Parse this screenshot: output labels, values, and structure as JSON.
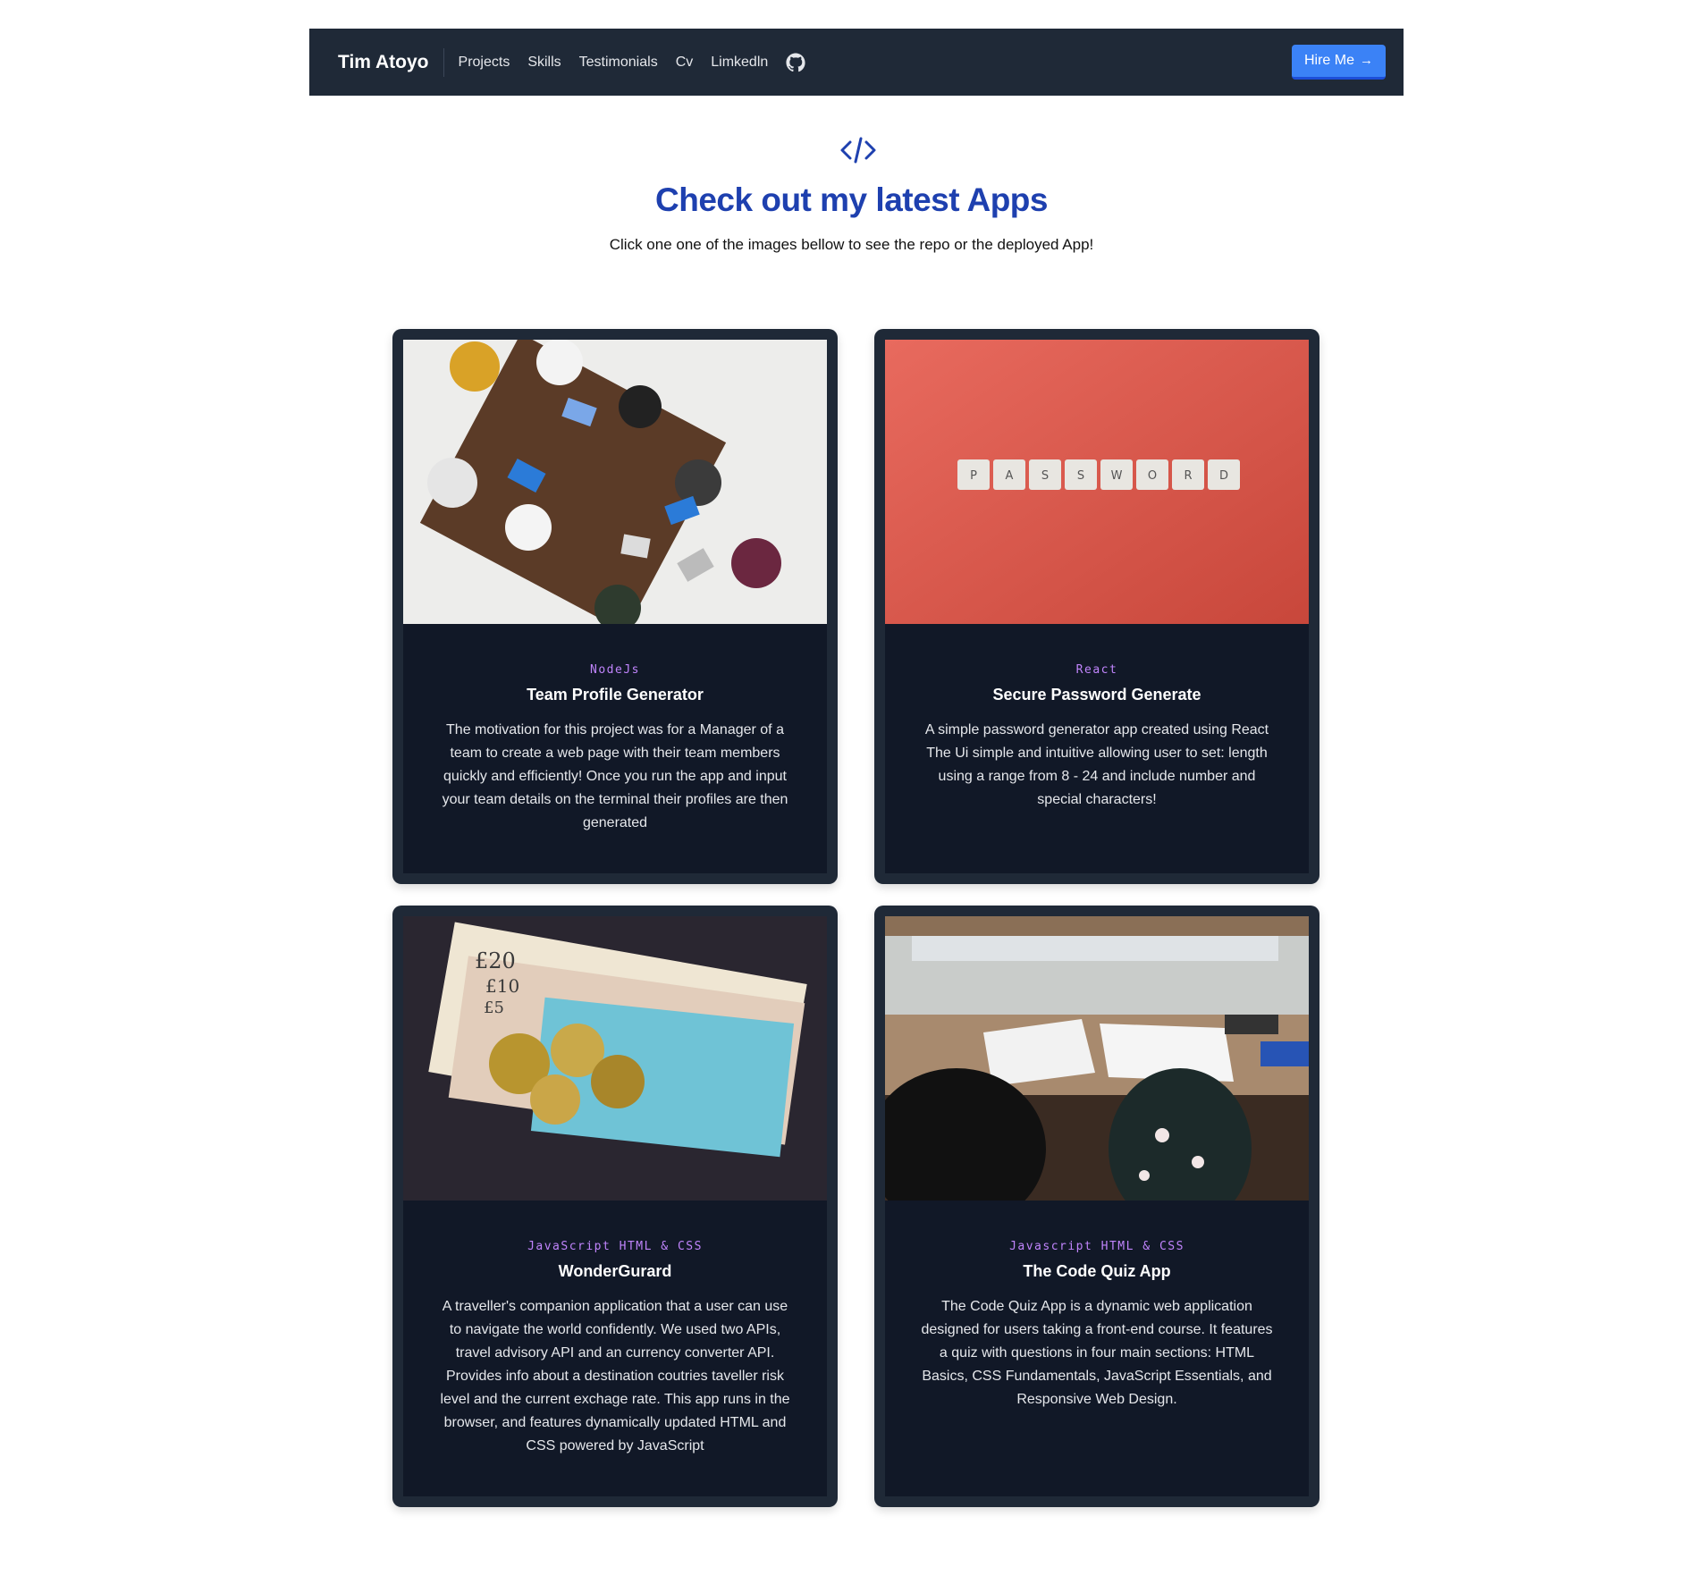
{
  "nav": {
    "brand": "Tim Atoyo",
    "links": [
      "Projects",
      "Skills",
      "Testimonials",
      "Cv",
      "Limkedln"
    ],
    "github_icon": "github-icon",
    "hire_label": "Hire Me",
    "hire_icon": "arrow-right-icon"
  },
  "header": {
    "icon": "code-icon",
    "title": "Check out my latest Apps",
    "subtitle": "Click one one of the images bellow to see the repo or the deployed App!"
  },
  "projects": [
    {
      "tag": "NodeJs",
      "title": "Team Profile Generator",
      "description": "The motivation for this project was for a Manager of a team to create a web page with their team members quickly and efficiently! Once you run the app and input your team details on the terminal their profiles are then generated",
      "image": "team-meeting-image"
    },
    {
      "tag": "React",
      "title": "Secure Password Generate",
      "description": "A simple password generator app created using React The Ui simple and intuitive allowing user to set: length using a range from 8 - 24 and include number and special characters!",
      "image": "password-tiles-image",
      "image_letters": [
        "P",
        "A",
        "S",
        "S",
        "W",
        "O",
        "R",
        "D"
      ]
    },
    {
      "tag": "JavaScript HTML & CSS",
      "title": "WonderGurard",
      "description": "A traveller's companion application that a user can use to navigate the world confidently. We used two APIs, travel advisory API and an currency converter API. Provides info about a destination coutries taveller risk level and the current exchage rate. This app runs in the browser, and features dynamically updated HTML and CSS powered by JavaScript",
      "image": "money-notes-image",
      "image_text": [
        "£20",
        "£10",
        "£5"
      ]
    },
    {
      "tag": "Javascript HTML & CSS",
      "title": "The Code Quiz App",
      "description": "The Code Quiz App is a dynamic web application designed for users taking a front-end course. It features a quiz with questions in four main sections: HTML Basics, CSS Fundamentals, JavaScript Essentials, and Responsive Web Design.",
      "image": "classroom-desk-image"
    }
  ],
  "colors": {
    "navbar": "#1f2937",
    "accent": "#3b82f6",
    "title": "#1e40af",
    "card_bg": "#111827",
    "tag": "#c084fc"
  }
}
